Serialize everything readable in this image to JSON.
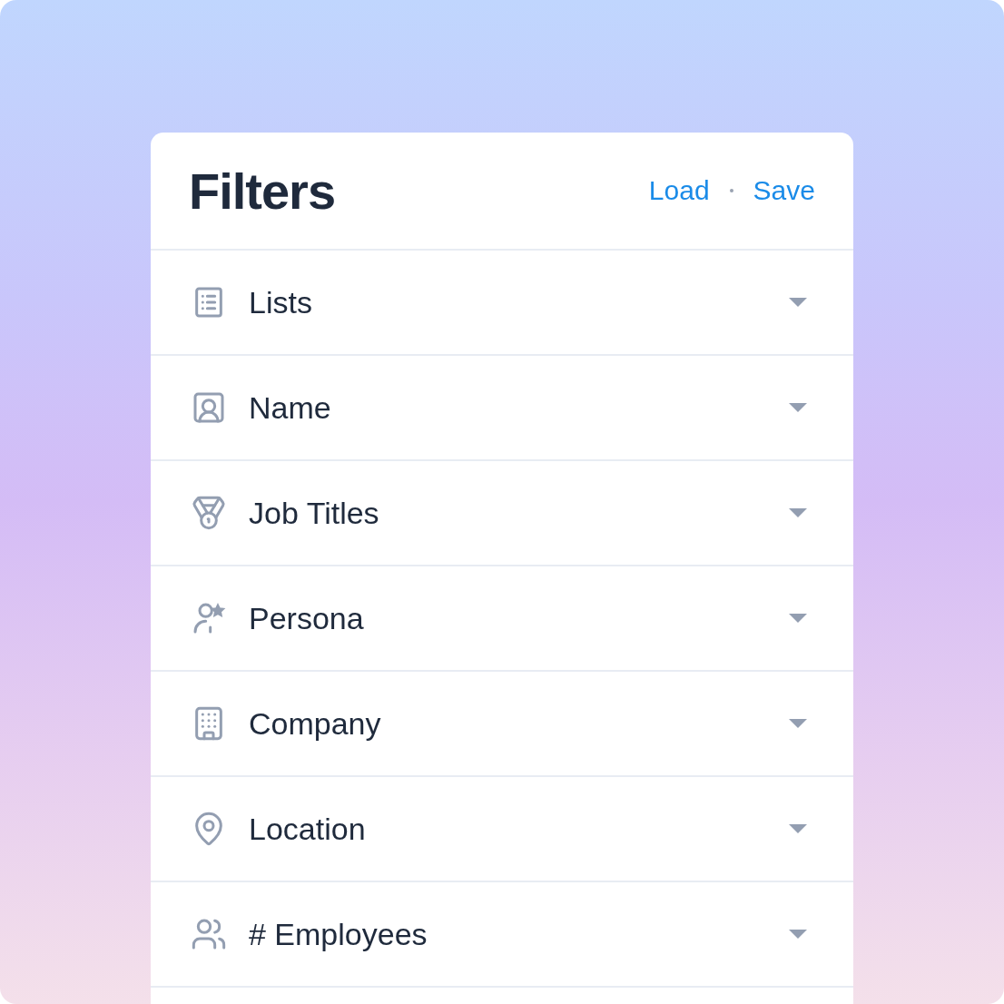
{
  "panel": {
    "title": "Filters",
    "actions": [
      "Load",
      "Save"
    ],
    "filters": [
      {
        "label": "Lists",
        "expanded": false
      },
      {
        "label": "Name",
        "expanded": false
      },
      {
        "label": "Job Titles",
        "expanded": false
      },
      {
        "label": "Persona",
        "expanded": false
      },
      {
        "label": "Company",
        "expanded": false
      },
      {
        "label": "Location",
        "expanded": false
      },
      {
        "label": "# Employees",
        "expanded": false
      }
    ]
  }
}
